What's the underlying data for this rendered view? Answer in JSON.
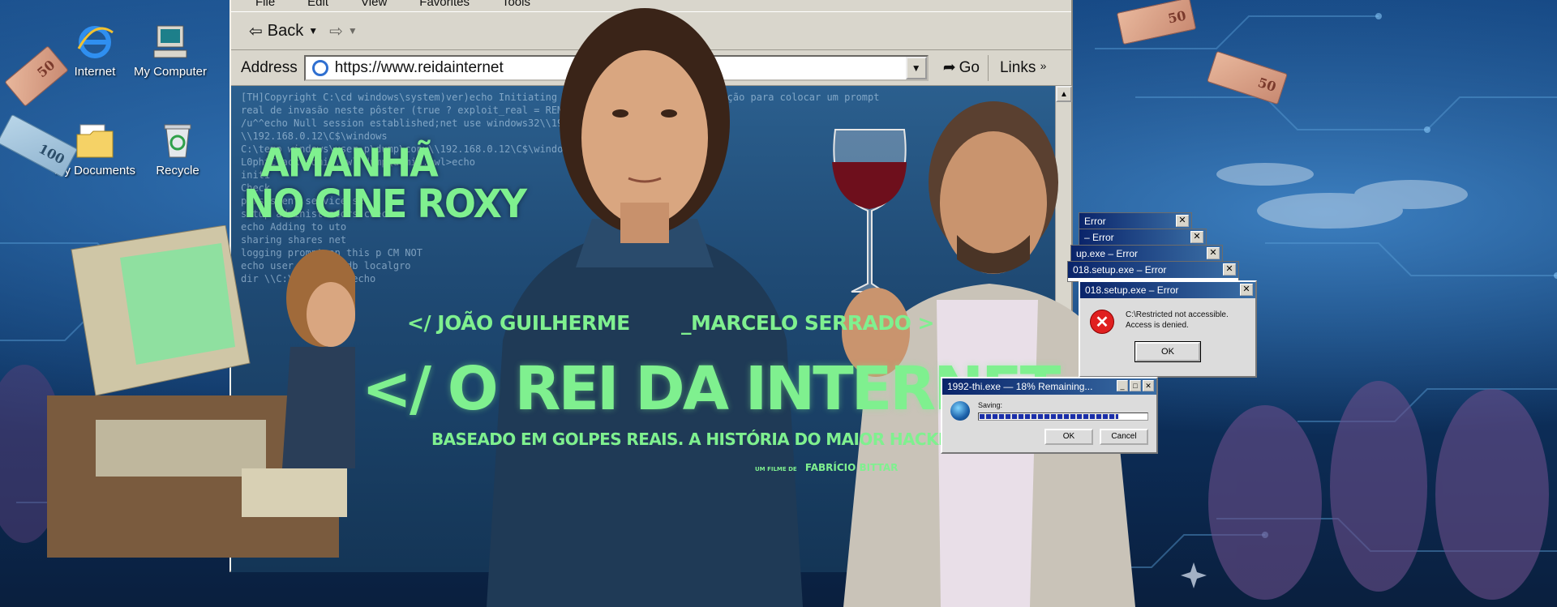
{
  "desktop": {
    "icons": [
      {
        "label": "Internet",
        "icon": "internet-explorer-icon"
      },
      {
        "label": "My Computer",
        "icon": "computer-icon"
      },
      {
        "label": "My Documents",
        "icon": "folder-icon"
      },
      {
        "label": "Recycle",
        "icon": "recycle-bin-icon"
      }
    ],
    "bills": [
      "50",
      "50",
      "100",
      "50"
    ]
  },
  "browser": {
    "menu": [
      "File",
      "Edit",
      "View",
      "Favorites",
      "Tools"
    ],
    "back_label": "Back",
    "address_label": "Address",
    "url": "https://www.reidainternet",
    "go_label": "Go",
    "links_label": "Links",
    "terminal_lines": [
      "[TH]Copyright C:\\cd windows\\system)ver)echo Initiating h                      designer não teve autorização para colocar um prompt",
      "real de invasão neste pôster (true ? exploit_real = REMOVIDO                        \\\\192.168",
      "     /u^^echo  Null  session  established;net  use                windows32\\\\192.168.0.12\\C$\\window",
      "                                                                   \\\\192.168.0.12\\C$\\windows",
      "C:\\temp                              windows\\user                 p\\dump\\copy\\\\192.168.0.12\\C$\\windo",
      "L0phtCrack                      admin.pwl                           dump\\admin.pwl>echo",
      "                                                                      initi",
      "                                                                      Check",
      "                 persistent  service                                  set",
      "                 setup administrators                                  chec",
      "                 echo Adding to                                        uto",
      "                 sharing  shares                                        net",
      "                 logging prompt on this p                               CM NOT",
      "                 echo user  account.db                                  localgro",
      "                 dir \\\\C:\\wind                                           b /f echo"
    ]
  },
  "poster": {
    "showtime_line1": "AMANHÃ",
    "showtime_line2": "NO CINE ROXY",
    "actor_1": "</ JOÃO GUILHERME",
    "actor_2": "_MARCELO SERRADO >",
    "title": "</ O REI DA INTERNET />",
    "tagline": "BASEADO EM GOLPES REAIS. A HISTÓRIA DO MAIOR HACKER DO BRASIL",
    "credit_prefix": "UM FILME DE",
    "credit_name": "FABRÍCIO BITTAR"
  },
  "error_dialogs": {
    "stack_titles": [
      "Error",
      "– Error",
      "up.exe – Error",
      "018.setup.exe – Error"
    ],
    "main_title": "018.setup.exe – Error",
    "message_line1": "C:\\Restricted not accessible.",
    "message_line2": "Access is denied.",
    "ok_label": "OK"
  },
  "progress_dialog": {
    "title": "1992-thi.exe — 18% Remaining...",
    "label": "Saving:",
    "progress": 0.82,
    "ok_label": "OK",
    "cancel_label": "Cancel"
  },
  "colors": {
    "accent_green": "#7ff08f",
    "title_bar": "#0a246a",
    "error_red": "#e02020"
  }
}
